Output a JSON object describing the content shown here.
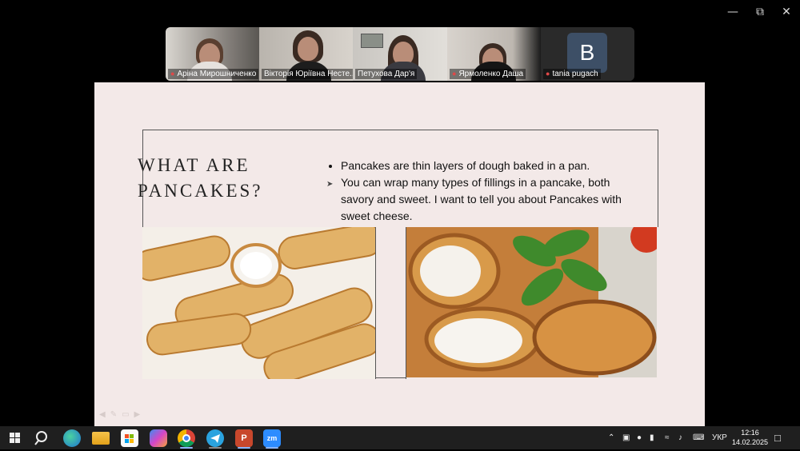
{
  "window": {
    "minimize_icon": "minimize-icon",
    "restore_icon": "restore-icon",
    "close_icon": "close-icon"
  },
  "participants": [
    {
      "name": "Аріна Мирошниченко",
      "muted": true
    },
    {
      "name": "Вікторія Юріївна Несте...",
      "muted": false
    },
    {
      "name": "Петухова Дар'я",
      "muted": false,
      "active": true
    },
    {
      "name": "Ярмоленко Даша",
      "muted": true
    },
    {
      "name": "tania pugach",
      "muted": true,
      "avatar_letter": "B"
    }
  ],
  "slide": {
    "title_line1": "WHAT ARE",
    "title_line2": "PANCAKES?",
    "bullet1": "Pancakes are thin layers of dough baked in a pan.",
    "paragraph": "You can wrap many types of fillings in a pancake, both savory and sweet. I want to tell you about Pancakes with sweet cheese."
  },
  "taskbar": {
    "language": "УКР",
    "time": "12:16",
    "date": "14.02.2025",
    "apps": [
      "start-icon",
      "search-icon",
      "edge-icon",
      "file-explorer-icon",
      "store-icon",
      "copilot-icon",
      "chrome-icon",
      "telegram-icon",
      "powerpoint-icon",
      "zoom-icon"
    ]
  },
  "colors": {
    "slide_bg": "#f3e9e8",
    "active_speaker": "#3fcf7a",
    "taskbar": "#1f1f1f"
  }
}
